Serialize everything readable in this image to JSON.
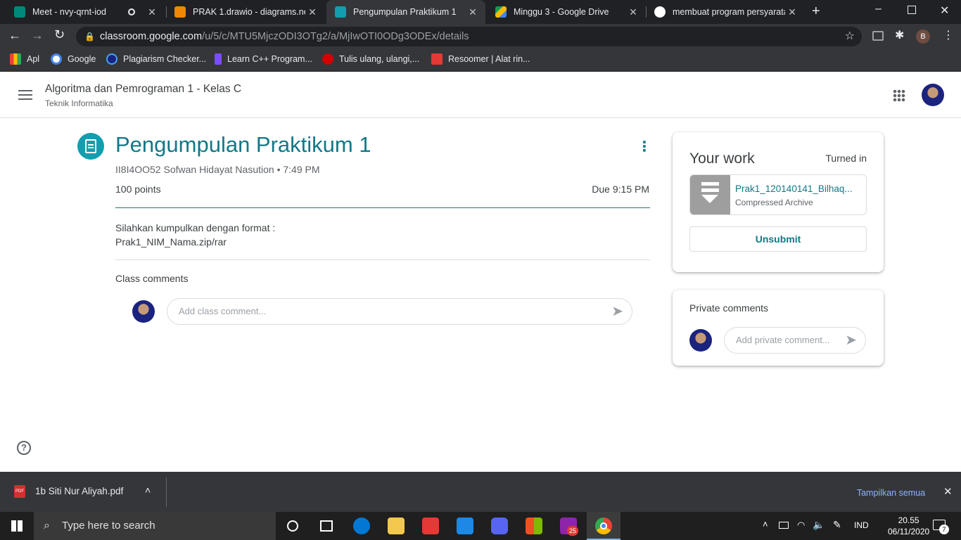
{
  "browser": {
    "tabs": [
      {
        "title": "Meet - nvy-qrnt-iod",
        "color": "#00897b",
        "active": false
      },
      {
        "title": "PRAK 1.drawio - diagrams.net",
        "color": "#f08705",
        "active": false
      },
      {
        "title": "Pengumpulan Praktikum 1",
        "color": "#129eaf",
        "active": true
      },
      {
        "title": "Minggu 3 - Google Drive",
        "color": "#fbbc04",
        "active": false
      },
      {
        "title": "membuat program persyaratan",
        "color": "#4285f4",
        "active": false
      }
    ],
    "url_host": "classroom.google.com",
    "url_path": "/u/5/c/MTU5MjczODI3OTg2/a/MjIwOTI0ODg3ODEx/details",
    "profile_initial": "B",
    "bookmarks": [
      {
        "label": "Apl",
        "color": "#ea4335"
      },
      {
        "label": "Google",
        "color": "#4285f4"
      },
      {
        "label": "Plagiarism Checker...",
        "color": "#1a73e8"
      },
      {
        "label": "Learn C++ Program...",
        "color": "#7c4dff"
      },
      {
        "label": "Tulis ulang, ulangi,...",
        "color": "#d50000"
      },
      {
        "label": "Resoomer | Alat rin...",
        "color": "#e53935"
      }
    ]
  },
  "header": {
    "course_title": "Algoritma dan Pemrograman 1 - Kelas C",
    "course_subtitle": "Teknik Informatika"
  },
  "assignment": {
    "title": "Pengumpulan Praktikum 1",
    "meta": "II8I4OO52 Sofwan Hidayat Nasution • 7:49 PM",
    "points": "100 points",
    "due": "Due 9:15 PM",
    "description_line1": "Silahkan kumpulkan dengan format :",
    "description_line2": "Prak1_NIM_Nama.zip/rar",
    "class_comments_title": "Class comments",
    "class_comment_placeholder": "Add class comment..."
  },
  "your_work": {
    "title": "Your work",
    "status": "Turned in",
    "attachment_name": "Prak1_120140141_Bilhaq...",
    "attachment_type": "Compressed Archive",
    "unsubmit_label": "Unsubmit"
  },
  "private_comments": {
    "title": "Private comments",
    "placeholder": "Add private comment..."
  },
  "download_bar": {
    "file_name": "1b Siti Nur Aliyah.pdf",
    "show_all": "Tampilkan semua"
  },
  "taskbar": {
    "search_placeholder": "Type here to search",
    "badge_count": "25",
    "language": "IND",
    "time": "20.55",
    "date": "06/11/2020",
    "notification_count": "7"
  },
  "colors": {
    "accent": "#137886",
    "brand_icon": "#129eaf"
  }
}
